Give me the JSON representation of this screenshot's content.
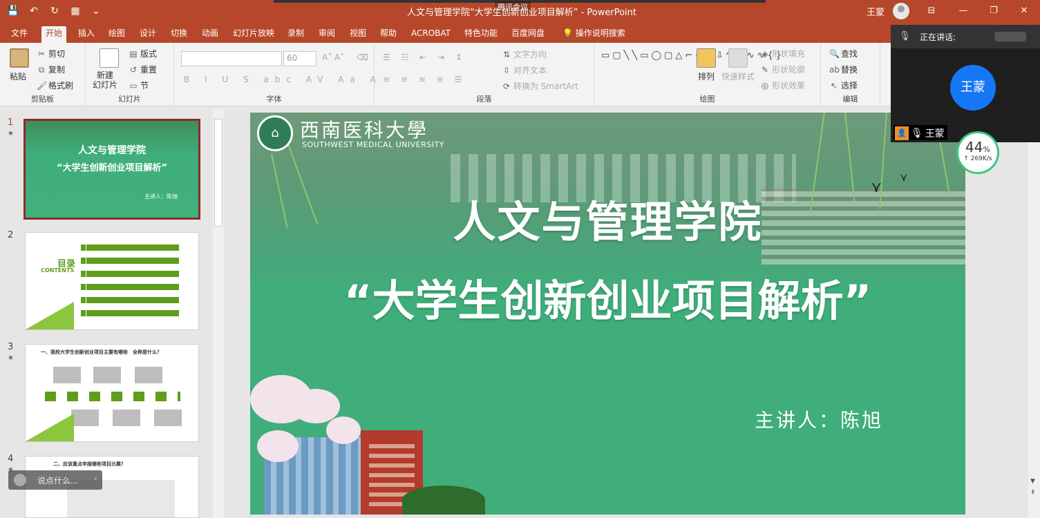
{
  "window": {
    "title": "人文与管理学院“大学生创新创业项目解析” - PowerPoint",
    "meeting_label": "腾讯会议",
    "user": "王蒙",
    "controls": [
      "⊟",
      "—",
      "❐",
      "✕"
    ]
  },
  "qat": [
    "save-icon",
    "undo-icon",
    "redo-icon",
    "present-icon",
    "customize-icon"
  ],
  "tabs": [
    "文件",
    "开始",
    "插入",
    "绘图",
    "设计",
    "切换",
    "动画",
    "幻灯片放映",
    "录制",
    "审阅",
    "视图",
    "帮助",
    "ACROBAT",
    "特色功能",
    "百度网盘",
    "操作说明搜索"
  ],
  "ribbon": {
    "clipboard": {
      "label": "剪贴板",
      "paste": "粘贴",
      "cut": "剪切",
      "copy": "复制",
      "format_painter": "格式刷"
    },
    "slides": {
      "label": "幻灯片",
      "new_slide": "新建\n幻灯片",
      "layout": "版式",
      "reset": "重置",
      "section": "节"
    },
    "font": {
      "label": "字体",
      "font_name": "",
      "font_size": "60"
    },
    "paragraph": {
      "label": "段落",
      "text_direction": "文字方向",
      "align_text": "对齐文本",
      "smartart": "转换为 SmartArt"
    },
    "drawing": {
      "label": "绘图",
      "arrange": "排列",
      "quick_styles": "快速样式",
      "shape_fill": "形状填充",
      "shape_outline": "形状轮廓",
      "shape_effects": "形状效果"
    },
    "editing": {
      "label": "编辑",
      "find": "查找",
      "replace": "替换",
      "select": "选择"
    }
  },
  "slides": [
    {
      "num": "1",
      "title1": "人文与管理学院",
      "title2": "“大学生创新创业项目解析”",
      "speaker": "主讲人：陈旭"
    },
    {
      "num": "2",
      "title": "目录",
      "subtitle": "CONTENTS",
      "items": [
        "1",
        "2",
        "3",
        "4",
        "5",
        "6"
      ]
    },
    {
      "num": "3",
      "title": "一、我校大学生创新创业项目主要有哪些　全称是什么？"
    },
    {
      "num": "4",
      "title": "二、应该重点申报哪些项目比赛？"
    }
  ],
  "main_slide": {
    "school_cn": "西南医科大學",
    "school_en": "SOUTHWEST MEDICAL UNIVERSITY",
    "title1": "人文与管理学院",
    "title2": "“大学生创新创业项目解析”",
    "speaker": "主讲人：陈旭"
  },
  "meeting": {
    "speaking_label": "正在讲话:",
    "speaker_name": "王蒙"
  },
  "network": {
    "percent": "44",
    "unit": "%",
    "speed": "↑ 269K/s"
  },
  "chat": {
    "placeholder": "说点什么..."
  },
  "colors": {
    "accent": "#b7472a",
    "meeting_blue": "#1677f5",
    "slide_green": "#3fae7b"
  }
}
